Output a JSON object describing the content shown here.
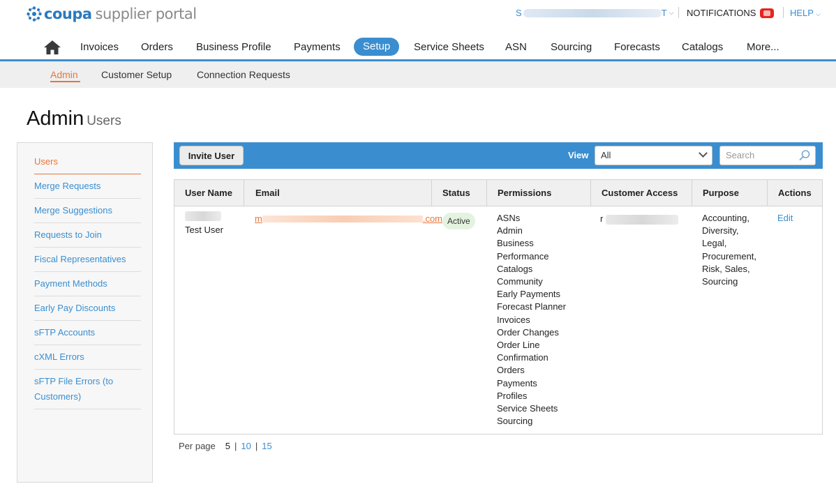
{
  "brand": {
    "coupa": "coupa",
    "portal": "supplier portal",
    "accent": "#3a8ed0",
    "highlight": "#e8743b"
  },
  "header": {
    "user_menu_initial": "S",
    "user_menu_suffix": "T",
    "notifications_label": "NOTIFICATIONS",
    "help_label": "HELP"
  },
  "main_nav": {
    "items": [
      "Invoices",
      "Orders",
      "Business Profile",
      "Payments",
      "Setup",
      "Service Sheets",
      "ASN",
      "Sourcing",
      "Forecasts",
      "Catalogs",
      "More..."
    ],
    "active": "Setup"
  },
  "sub_nav": {
    "items": [
      "Admin",
      "Customer Setup",
      "Connection Requests"
    ],
    "active": "Admin"
  },
  "page": {
    "title": "Admin",
    "subtitle": "Users"
  },
  "side_menu": {
    "items": [
      "Users",
      "Merge Requests",
      "Merge Suggestions",
      "Requests to Join",
      "Fiscal Representatives",
      "Payment Methods",
      "Early Pay Discounts",
      "sFTP Accounts",
      "cXML Errors",
      "sFTP File Errors (to Customers)"
    ],
    "active": "Users"
  },
  "toolbar": {
    "invite_label": "Invite User",
    "view_label": "View",
    "view_value": "All",
    "search_placeholder": "Search"
  },
  "table": {
    "headers": [
      "User Name",
      "Email",
      "Status",
      "Permissions",
      "Customer Access",
      "Purpose",
      "Actions"
    ],
    "rows": [
      {
        "user_name": "Test User",
        "email_start": "m",
        "email_end": ".com",
        "status": "Active",
        "permissions": [
          "ASNs",
          "Admin",
          "Business",
          "Performance",
          "Catalogs",
          "Community",
          "Early Payments",
          "Forecast Planner",
          "Invoices",
          "Order Changes",
          "Order Line",
          "Confirmation",
          "Orders",
          "Payments",
          "Profiles",
          "Service Sheets",
          "Sourcing"
        ],
        "customer_access_initial": "r",
        "purpose": [
          "Accounting,",
          "Diversity,",
          "Legal,",
          "Procurement,",
          "Risk, Sales,",
          "Sourcing"
        ],
        "action": "Edit"
      }
    ]
  },
  "pager": {
    "label": "Per page",
    "options": [
      "5",
      "10",
      "15"
    ],
    "current": "5"
  }
}
